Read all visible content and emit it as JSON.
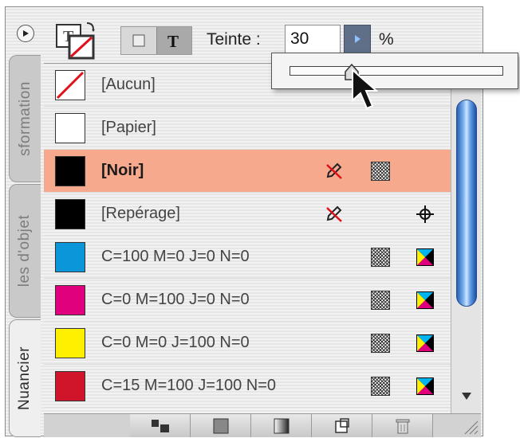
{
  "header": {
    "tint_label": "Teinte :",
    "tint_value": "30",
    "percent": "%"
  },
  "side_tabs": [
    "sformation",
    "les d'objet",
    "Nuancier"
  ],
  "swatches": [
    {
      "name": "[Aucun]",
      "color": "none"
    },
    {
      "name": "[Papier]",
      "color": "#ffffff"
    },
    {
      "name": "[Noir]",
      "color": "#000000"
    },
    {
      "name": "[Repérage]",
      "color": "#000000"
    },
    {
      "name": "C=100 M=0 J=0 N=0",
      "color": "#0a96d8"
    },
    {
      "name": "C=0 M=100 J=0 N=0",
      "color": "#e0007d"
    },
    {
      "name": "C=0 M=0 J=100 N=0",
      "color": "#fff000"
    },
    {
      "name": "C=15 M=100 J=100 N=0",
      "color": "#d0142a"
    }
  ],
  "tint_slider_fraction": 0.3,
  "accent": {
    "selection": "#f6a98d",
    "scroll_thumb": "#3f7fd0"
  }
}
